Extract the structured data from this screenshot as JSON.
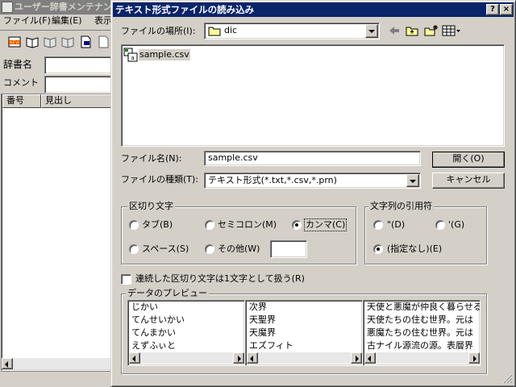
{
  "background_window": {
    "title": "ユーザー辞書メンテナンス",
    "menu": [
      "ファイル(F)",
      "編集(E)",
      "表示"
    ],
    "fields": {
      "dictionary_name_label": "辞書名",
      "comment_label": "コメント"
    },
    "columns": [
      "番号",
      "見出し"
    ]
  },
  "dialog": {
    "title": "テキスト形式ファイルの読み込み",
    "help_button": "?",
    "close_button": "×",
    "location_label": "ファイルの場所(I):",
    "location_value": "dic",
    "files": [
      "sample.csv"
    ],
    "filename_label": "ファイル名(N):",
    "filename_value": "sample.csv",
    "filetype_label": "ファイルの種類(T):",
    "filetype_value": "テキスト形式(*.txt,*.csv,*.prn)",
    "open_button": "開く(O)",
    "cancel_button": "キャンセル",
    "delimiter": {
      "group_label": "区切り文字",
      "tab": "タブ(B)",
      "semicolon": "セミコロン(M)",
      "comma": "カンマ(C)",
      "space": "スペース(S)",
      "other": "その他(W)",
      "selected": "comma"
    },
    "quote": {
      "group_label": "文字列の引用符",
      "double": "\"(D)",
      "single": "'(G)",
      "none": "(指定なし)(E)",
      "selected": "none"
    },
    "consecutive_label": "連続した区切り文字は1文字として扱う(R)",
    "preview": {
      "group_label": "データのプレビュー",
      "col1": [
        "じかい",
        "てんせいかい",
        "てんまかい",
        "えずふぃと"
      ],
      "col2": [
        "次界",
        "天聖界",
        "天魔界",
        "エズフィト"
      ],
      "col3": [
        "天使と悪魔が仲良く暮らせる",
        "天使たちの住む世界。元は",
        "悪魔たちの住む世界。元は",
        "古ナイル源流の源。表層界"
      ]
    }
  }
}
